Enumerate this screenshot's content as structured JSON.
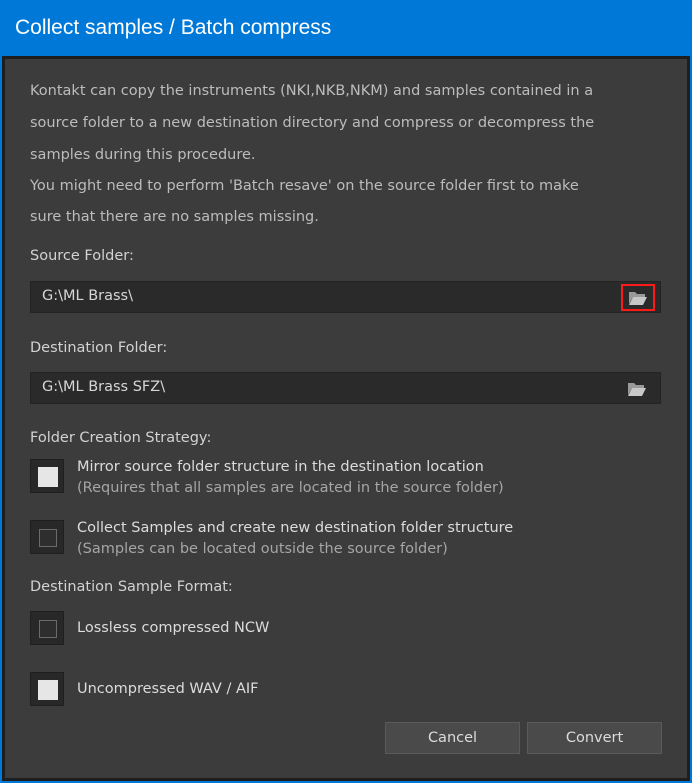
{
  "window": {
    "title": "Collect samples / Batch compress"
  },
  "description": [
    "Kontakt can copy the instruments (NKI,NKB,NKM) and samples contained in a",
    "source folder to a new destination directory and compress or decompress the",
    "samples during this procedure.",
    "You might need to perform 'Batch resave' on the source folder first to make",
    "sure that there are no samples missing."
  ],
  "source": {
    "label": "Source Folder:",
    "value": "G:\\ML Brass\\"
  },
  "destination": {
    "label": "Destination Folder:",
    "value": "G:\\ML Brass SFZ\\"
  },
  "strategy": {
    "label": "Folder Creation Strategy:",
    "options": [
      {
        "main": "Mirror source folder structure in the destination location",
        "sub": "(Requires that all samples are located in the source folder)",
        "checked": true
      },
      {
        "main": "Collect Samples and create new destination folder structure",
        "sub": "(Samples can be located outside the source folder)",
        "checked": false
      }
    ]
  },
  "format": {
    "label": "Destination Sample Format:",
    "options": [
      {
        "main": "Lossless compressed NCW",
        "checked": false
      },
      {
        "main": "Uncompressed WAV / AIF",
        "checked": true
      }
    ]
  },
  "buttons": {
    "cancel": "Cancel",
    "convert": "Convert"
  },
  "icons": {
    "browse": "folder-open-icon"
  },
  "colors": {
    "titlebar": "#0078d7",
    "panel": "#3c3c3c",
    "highlight": "#ff1a1a"
  }
}
